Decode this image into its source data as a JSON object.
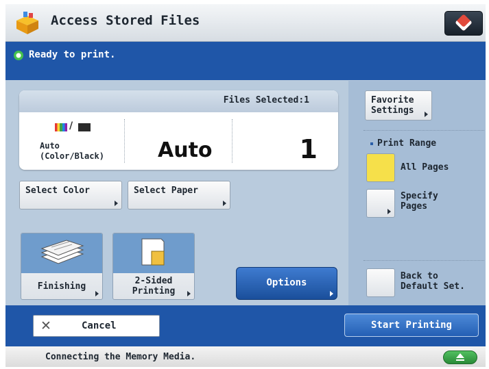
{
  "header": {
    "title": "Access Stored Files",
    "app_icon": "storage-box-icon",
    "top_right_icon": "settings-cube-icon"
  },
  "status": {
    "text": "Ready to print.",
    "icon": "ready-status-icon",
    "color": "#45c04d"
  },
  "files_panel": {
    "files_selected_label": "Files Selected:1",
    "color_mode_icon": "color-black-icon",
    "color_mode_text": "Auto\n(Color/Black)",
    "paper_value": "Auto",
    "copies_value": "1"
  },
  "buttons": {
    "select_color": "Select Color",
    "select_paper": "Select Paper",
    "finishing": "Finishing",
    "two_sided": "2-Sided\nPrinting",
    "options": "Options"
  },
  "right_panel": {
    "favorite_settings": "Favorite\nSettings",
    "print_range_title": "Print Range",
    "all_pages": "All Pages",
    "specify_pages": "Specify\nPages",
    "back_to_default": "Back to\nDefault Set.",
    "selected_range": "All Pages",
    "selected_color": "#f6e04a"
  },
  "bottom": {
    "cancel": "Cancel",
    "start_printing": "Start Printing"
  },
  "footer": {
    "text": "Connecting the Memory Media.",
    "eject_icon": "eject-icon"
  },
  "colors": {
    "bar_blue": "#1f56a8",
    "panel_blue": "#b9cbdd",
    "accent_tile": "#6f9ccc"
  }
}
